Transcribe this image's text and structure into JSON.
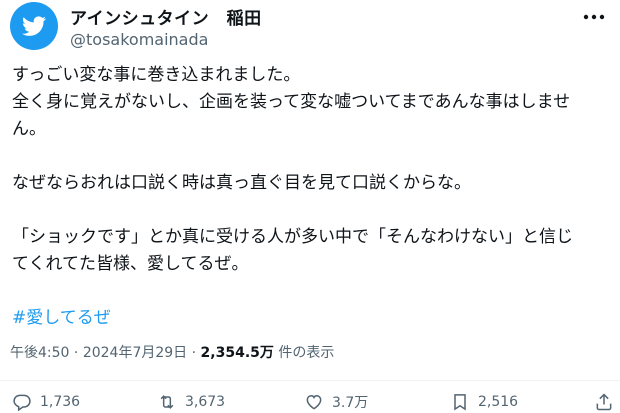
{
  "account": {
    "display_name": "アインシュタイン　稲田",
    "handle": "@tosakomainada",
    "brand_color": "#1d9bf0"
  },
  "tweet": {
    "lines": [
      "すっごい変な事に巻き込まれました。",
      "全く身に覚えがないし、企画を装って変な嘘ついてまであんな事はしませ",
      "ん。",
      "なぜならおれは口説く時は真っ直ぐ目を見て口説くからな。",
      "「ショックです」とか真に受ける人が多い中で「そんなわけない」と信じ",
      "てくれてた皆様、愛してるぜ。"
    ],
    "hashtag": "#愛してるぜ"
  },
  "meta": {
    "time": "午後4:50",
    "separator": "·",
    "date": "2024年7月29日",
    "views": "2,354.5万",
    "views_label": "件の表示"
  },
  "actions": {
    "replies": "1,736",
    "reposts": "3,673",
    "likes": "3.7万",
    "bookmarks": "2,516",
    "icons": [
      "reply-icon",
      "repost-icon",
      "like-icon",
      "bookmark-icon",
      "share-icon"
    ]
  },
  "colors": {
    "text": "#0f1419",
    "secondary": "#536471",
    "link": "#1d9bf0"
  }
}
